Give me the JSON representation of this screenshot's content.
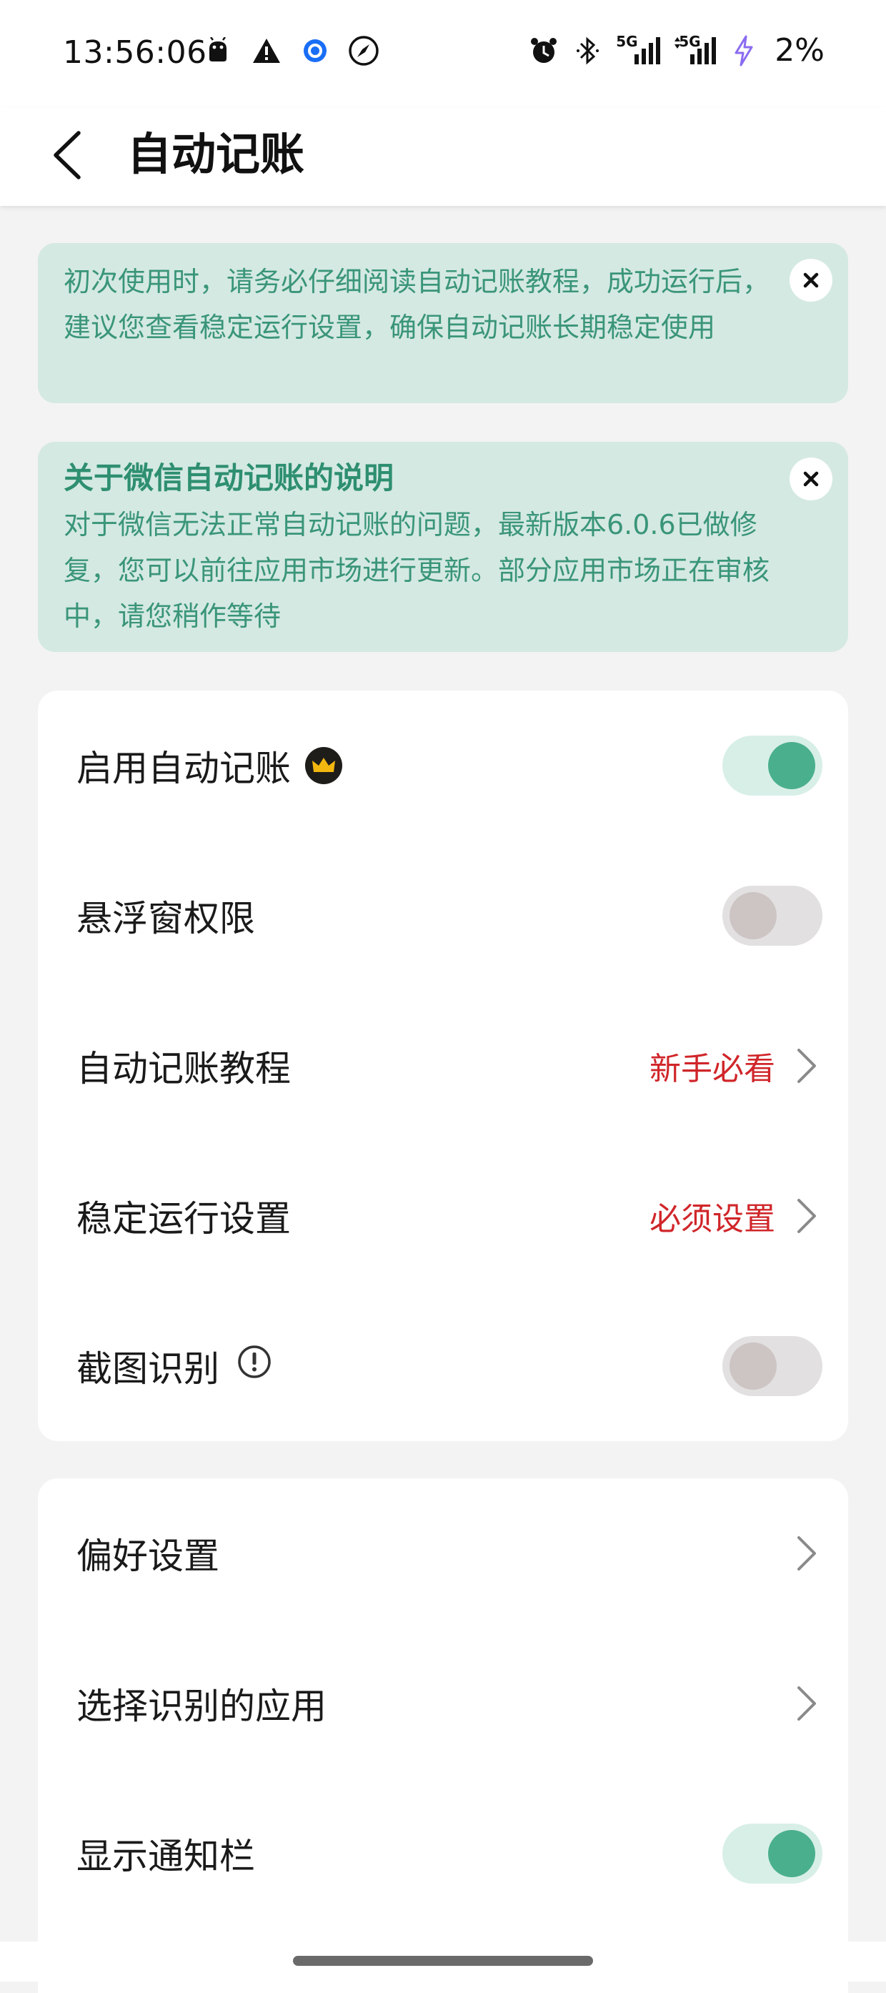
{
  "status_bar": {
    "time": "13:56:06",
    "network_labels": [
      "5G",
      "5G"
    ],
    "battery": "2%"
  },
  "app_bar": {
    "title": "自动记账"
  },
  "notices": [
    {
      "text": "初次使用时，请务必仔细阅读自动记账教程，成功运行后，建议您查看稳定运行设置，确保自动记账长期稳定使用"
    },
    {
      "title": "关于微信自动记账的说明",
      "text": "对于微信无法正常自动记账的问题，最新版本6.0.6已做修复，您可以前往应用市场进行更新。部分应用市场正在审核中，请您稍作等待"
    }
  ],
  "settings_group_1": [
    {
      "label": "启用自动记账",
      "control": "toggle",
      "state": "on"
    },
    {
      "label": "悬浮窗权限",
      "control": "toggle",
      "state": "off"
    },
    {
      "label": "自动记账教程",
      "control": "link",
      "value": "新手必看"
    },
    {
      "label": "稳定运行设置",
      "control": "link",
      "value": "必须设置"
    },
    {
      "label": "截图识别",
      "control": "toggle",
      "state": "off"
    }
  ],
  "settings_group_2": [
    {
      "label": "偏好设置",
      "control": "link"
    },
    {
      "label": "选择识别的应用",
      "control": "link"
    },
    {
      "label": "显示通知栏",
      "control": "toggle",
      "state": "on"
    }
  ],
  "colors": {
    "accent_green": "#4aaf8d",
    "notice_bg": "#d4e9e2",
    "notice_text": "#3a9579",
    "warning_red": "#d0262a"
  }
}
